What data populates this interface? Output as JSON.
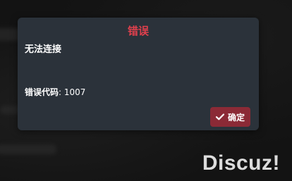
{
  "dialog": {
    "title": "错误",
    "message": "无法连接",
    "error_label": "错误代码",
    "error_separator": ":",
    "error_code": "1007",
    "confirm_label": "确定",
    "confirm_icon": "check-icon"
  },
  "watermark": {
    "text": "Discuz!"
  },
  "colors": {
    "dialog_background": "#2b323a",
    "title_color": "#e0404d",
    "button_background": "#8b2a36",
    "page_background": "#131313"
  }
}
